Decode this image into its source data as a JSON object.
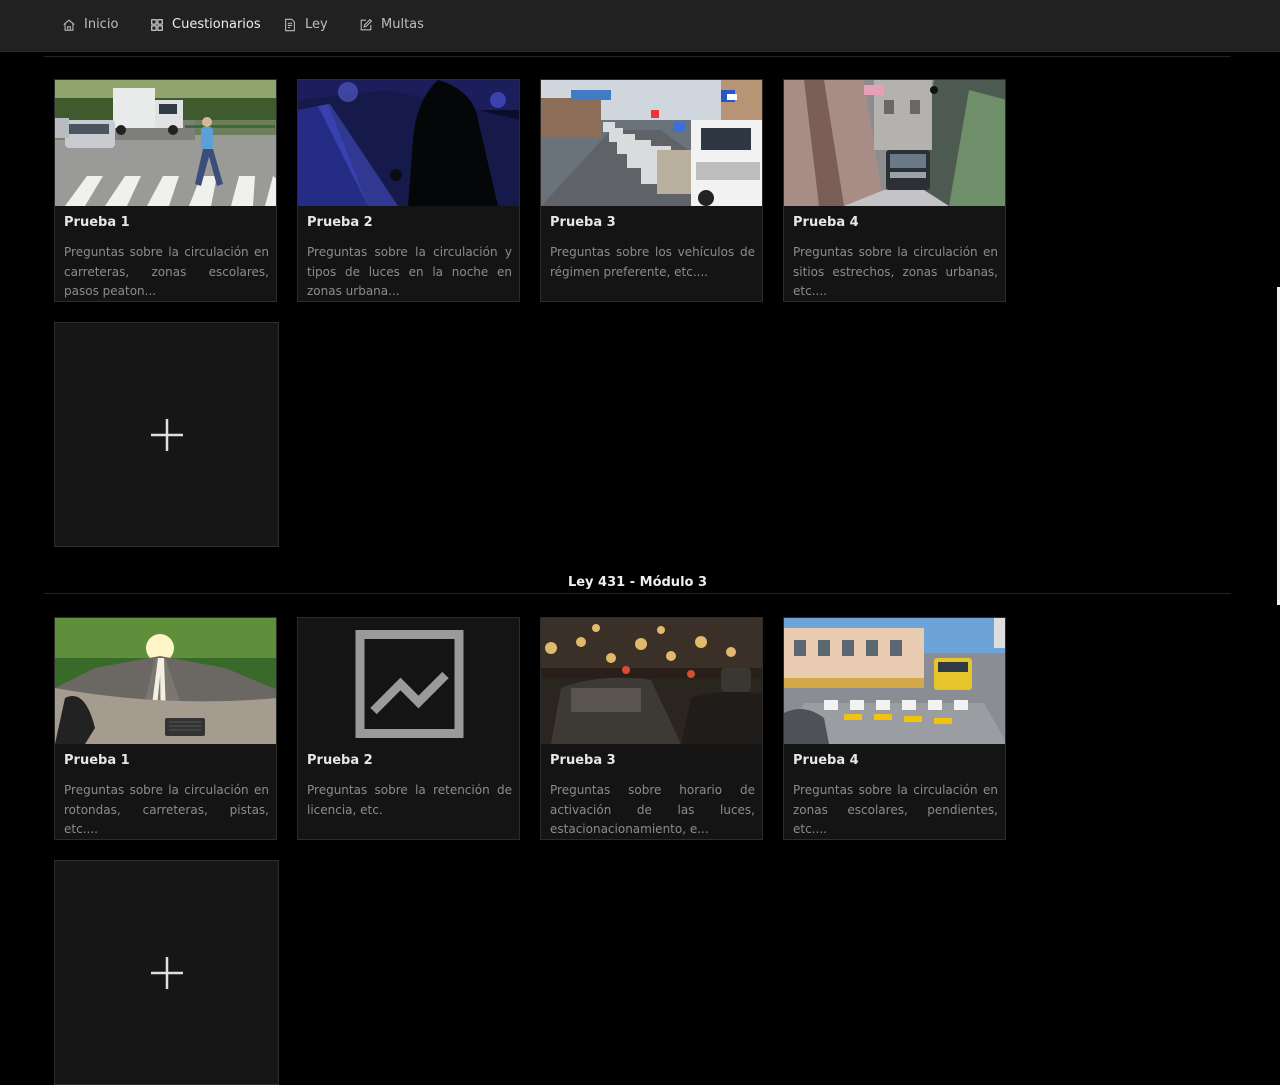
{
  "nav": {
    "items": [
      {
        "label": "Inicio",
        "icon": "home-icon"
      },
      {
        "label": "Cuestionarios",
        "icon": "grid-icon"
      },
      {
        "label": "Ley",
        "icon": "document-icon"
      },
      {
        "label": "Multas",
        "icon": "edit-icon"
      }
    ],
    "active": "Cuestionarios"
  },
  "section1": {
    "cards": [
      {
        "title": "Prueba 1",
        "description": "Preguntas sobre la circulación en carreteras, zonas escolares, pasos peaton..."
      },
      {
        "title": "Prueba 2",
        "description": "Preguntas sobre la circulación y tipos de luces en la noche en zonas urbana..."
      },
      {
        "title": "Prueba 3",
        "description": "Preguntas sobre los vehículos de régimen preferente, etc...."
      },
      {
        "title": "Prueba 4",
        "description": "Preguntas sobre la circulación en sitios estrechos, zonas urbanas, etc...."
      }
    ]
  },
  "section2": {
    "title": "Ley 431 - Módulo 3",
    "cards": [
      {
        "title": "Prueba 1",
        "description": "Preguntas sobre la circulación en rotondas, carreteras, pistas, etc...."
      },
      {
        "title": "Prueba 2",
        "description": "Preguntas sobre la retención de licencia, etc.",
        "image_alt": "quiz"
      },
      {
        "title": "Prueba 3",
        "description": "Preguntas sobre horario de activación de las luces, estacionacionamiento, e..."
      },
      {
        "title": "Prueba 4",
        "description": "Preguntas sobre la circulación en zonas escolares, pendientes, etc...."
      }
    ]
  },
  "colors": {
    "background": "#000000",
    "topbar": "#212121",
    "card": "#141414",
    "text": "#e6e6e6",
    "muted": "#8c8c8c"
  }
}
